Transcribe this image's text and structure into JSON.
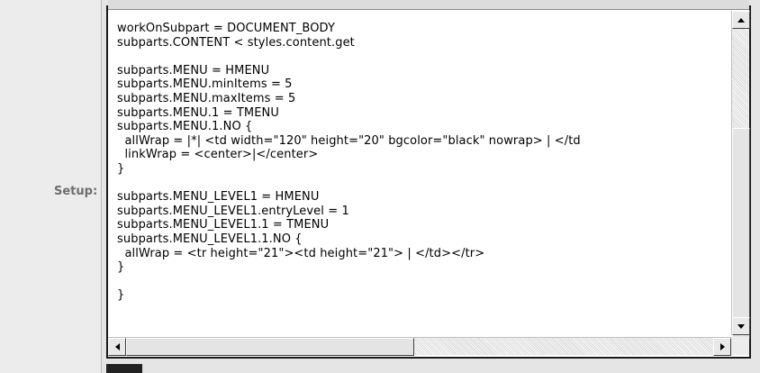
{
  "form": {
    "setup_label": "Setup:"
  },
  "editor": {
    "lines": [
      "workOnSubpart = DOCUMENT_BODY",
      "subparts.CONTENT < styles.content.get",
      "",
      "subparts.MENU = HMENU",
      "subparts.MENU.minItems = 5",
      "subparts.MENU.maxItems = 5",
      "subparts.MENU.1 = TMENU",
      "subparts.MENU.1.NO {",
      "  allWrap = |*| <td width=\"120\" height=\"20\" bgcolor=\"black\" nowrap> | </td",
      "  linkWrap = <center>|</center>",
      "}",
      "",
      "subparts.MENU_LEVEL1 = HMENU",
      "subparts.MENU_LEVEL1.entryLevel = 1",
      "subparts.MENU_LEVEL1.1 = TMENU",
      "subparts.MENU_LEVEL1.1.NO {",
      "  allWrap = <tr height=\"21\"><td height=\"21\"> | </td></tr>",
      "}",
      "",
      "}"
    ],
    "icons": {
      "scroll_up": "arrow-up-icon",
      "scroll_down": "arrow-down-icon",
      "scroll_left": "arrow-left-icon",
      "scroll_right": "arrow-right-icon"
    }
  }
}
